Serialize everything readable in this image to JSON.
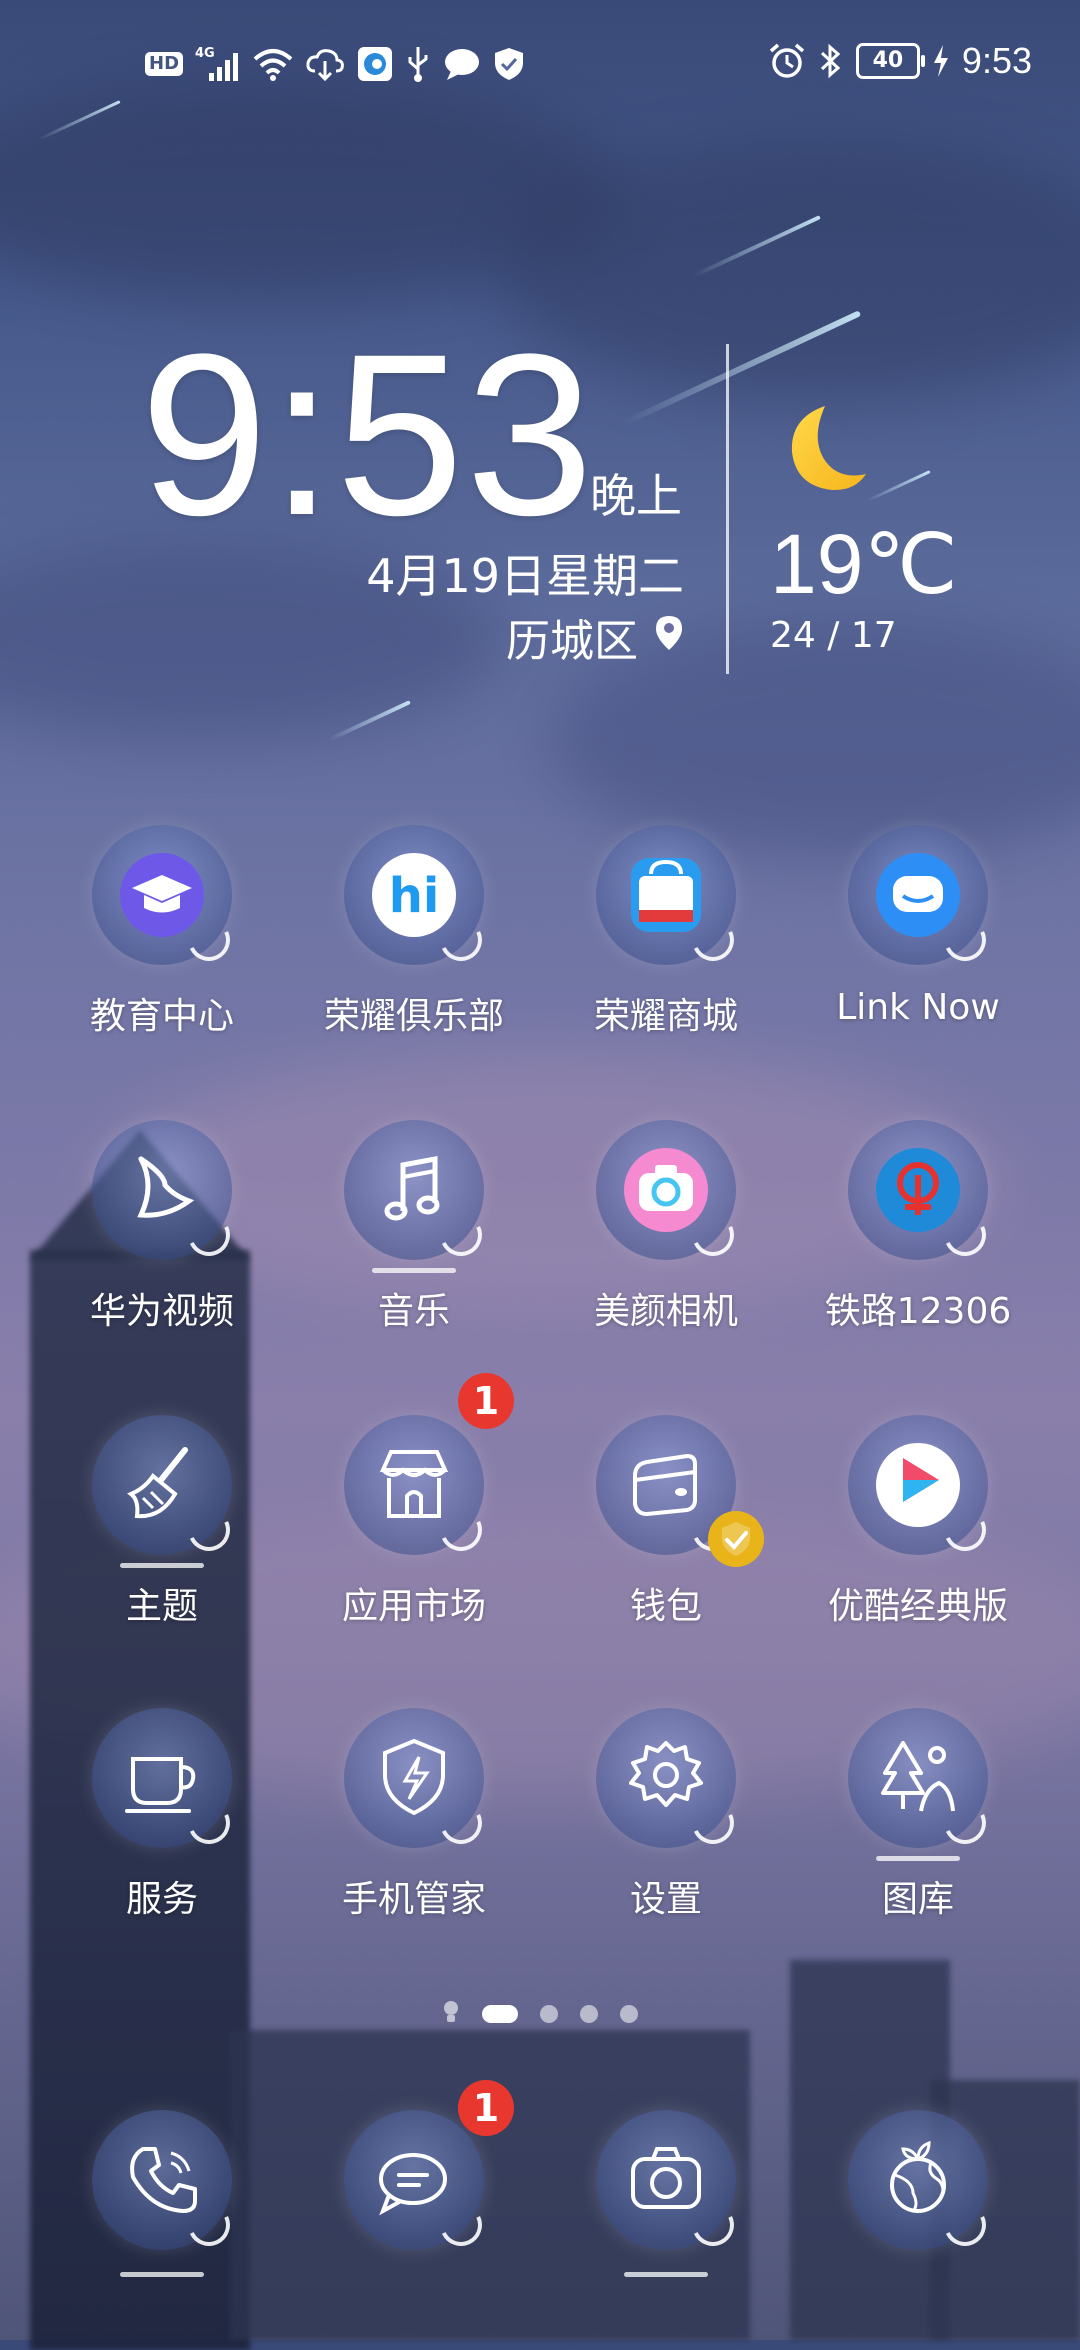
{
  "status_bar": {
    "left_icons": [
      "hd-icon",
      "signal-4g-icon",
      "wifi-icon",
      "cloud-download-icon",
      "browser-app-icon",
      "usb-icon",
      "message-icon",
      "shield-icon"
    ],
    "hd_label": "HD",
    "network_label": "4G",
    "right_icons": [
      "alarm-icon",
      "bluetooth-icon",
      "battery-icon",
      "charging-icon"
    ],
    "battery_level": "40",
    "time": "9:53"
  },
  "clock_widget": {
    "time": "9:53",
    "period": "晚上",
    "date": "4月19日星期二",
    "location": "历城区",
    "weather_icon": "moon-icon",
    "temperature": "19℃",
    "temp_range": "24 / 17"
  },
  "apps": [
    {
      "label": "教育中心",
      "icon": "education-cap-icon"
    },
    {
      "label": "荣耀俱乐部",
      "icon": "honor-club-icon"
    },
    {
      "label": "荣耀商城",
      "icon": "honor-store-icon"
    },
    {
      "label": "Link Now",
      "icon": "link-now-icon"
    },
    {
      "label": "华为视频",
      "icon": "video-icon"
    },
    {
      "label": "音乐",
      "icon": "music-note-icon"
    },
    {
      "label": "美颜相机",
      "icon": "beauty-camera-icon"
    },
    {
      "label": "铁路12306",
      "icon": "railway-icon"
    },
    {
      "label": "主题",
      "icon": "brush-icon"
    },
    {
      "label": "应用市场",
      "icon": "app-market-icon",
      "badge": "1"
    },
    {
      "label": "钱包",
      "icon": "wallet-icon"
    },
    {
      "label": "优酷经典版",
      "icon": "youku-icon"
    },
    {
      "label": "服务",
      "icon": "coffee-cup-icon"
    },
    {
      "label": "手机管家",
      "icon": "phone-manager-shield-icon"
    },
    {
      "label": "设置",
      "icon": "gear-icon"
    },
    {
      "label": "图库",
      "icon": "gallery-icon"
    }
  ],
  "page_indicator": {
    "pages": 4,
    "active_page": 1,
    "hint_icon": "lightbulb-icon"
  },
  "dock": [
    {
      "icon": "phone-icon"
    },
    {
      "icon": "messages-icon",
      "badge": "1"
    },
    {
      "icon": "camera-icon"
    },
    {
      "icon": "browser-globe-icon"
    }
  ]
}
